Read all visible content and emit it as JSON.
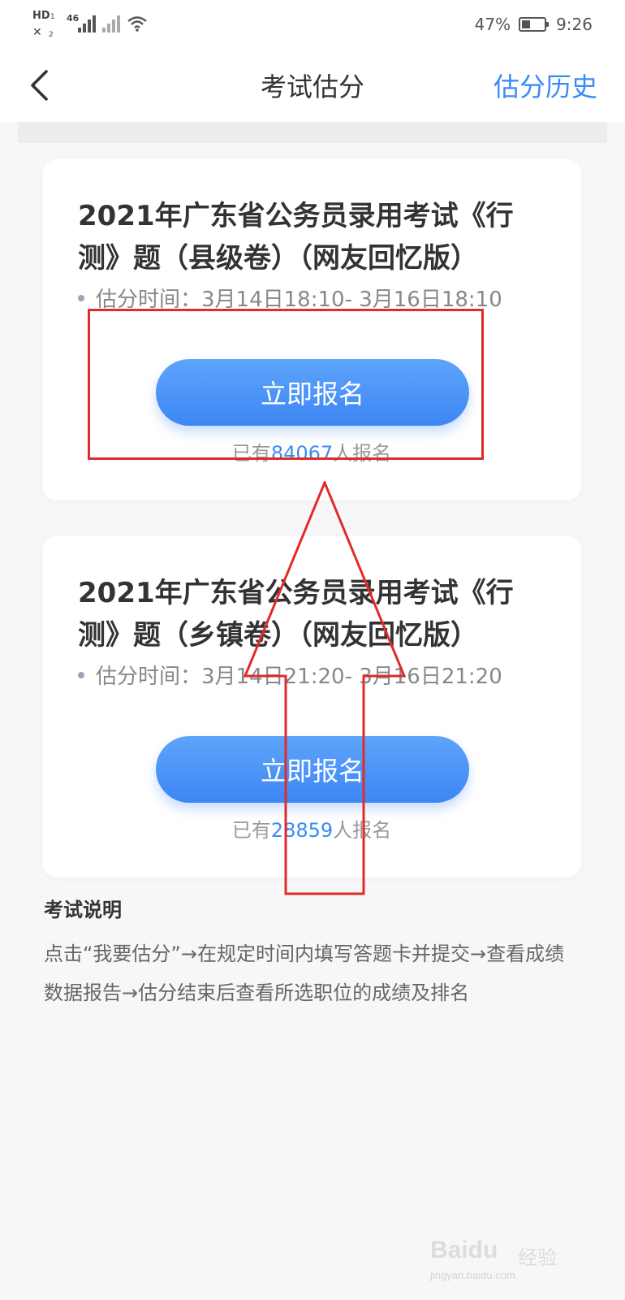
{
  "status_bar": {
    "hd": "HD",
    "hd_sub": "1",
    "network": "46",
    "sim2": "2",
    "battery_percent": "47%",
    "battery_level": 0.47,
    "time": "9:26"
  },
  "nav": {
    "title": "考试估分",
    "history_label": "估分历史",
    "back_icon": "chevron-left-icon"
  },
  "cards": [
    {
      "title": "2021年广东省公务员录用考试《行测》题（县级卷）（网友回忆版）",
      "time_label": "估分时间：",
      "time_range": "3月14日18:10- 3月16日18:10",
      "button_label": "立即报名",
      "count_prefix": "已有",
      "count": "84067",
      "count_suffix": "人报名"
    },
    {
      "title": "2021年广东省公务员录用考试《行测》题（乡镇卷）（网友回忆版）",
      "time_label": "估分时间：",
      "time_range": "3月14日21:20- 3月16日21:20",
      "button_label": "立即报名",
      "count_prefix": "已有",
      "count": "28859",
      "count_suffix": "人报名"
    }
  ],
  "explanation": {
    "title": "考试说明",
    "text": "点击“我要估分”→在规定时间内填写答题卡并提交→查看成绩数据报告→估分结束后查看所选职位的成绩及排名"
  },
  "watermark": {
    "main": "Baidu",
    "cn": "经验",
    "sub": "jingyan.baidu.com"
  },
  "colors": {
    "accent": "#3a8cf5",
    "annotation": "#e02b2b",
    "background": "#f7f7f9"
  }
}
